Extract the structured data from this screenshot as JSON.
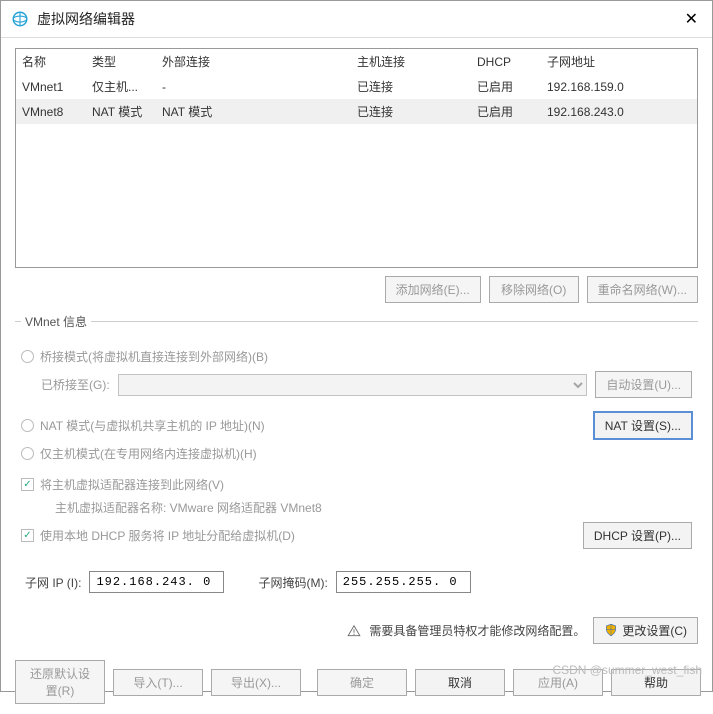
{
  "window": {
    "title": "虚拟网络编辑器"
  },
  "grid": {
    "headers": {
      "name": "名称",
      "type": "类型",
      "ext": "外部连接",
      "host": "主机连接",
      "dhcp": "DHCP",
      "subnet": "子网地址"
    },
    "rows": [
      {
        "name": "VMnet1",
        "type": "仅主机...",
        "ext": "-",
        "host": "已连接",
        "dhcp": "已启用",
        "subnet": "192.168.159.0"
      },
      {
        "name": "VMnet8",
        "type": "NAT 模式",
        "ext": "NAT 模式",
        "host": "已连接",
        "dhcp": "已启用",
        "subnet": "192.168.243.0"
      }
    ]
  },
  "buttons": {
    "add_net": "添加网络(E)...",
    "remove_net": "移除网络(O)",
    "rename_net": "重命名网络(W)...",
    "auto_set": "自动设置(U)...",
    "nat_set": "NAT 设置(S)...",
    "dhcp_set": "DHCP 设置(P)...",
    "change_set": "更改设置(C)",
    "restore": "还原默认设置(R)",
    "import": "导入(T)...",
    "export": "导出(X)...",
    "ok": "确定",
    "cancel": "取消",
    "apply": "应用(A)",
    "help": "帮助"
  },
  "info": {
    "legend": "VMnet 信息",
    "bridge": "桥接模式(将虚拟机直接连接到外部网络)(B)",
    "bridge_to": "已桥接至(G):",
    "nat": "NAT 模式(与虚拟机共享主机的 IP 地址)(N)",
    "hostonly": "仅主机模式(在专用网络内连接虚拟机)(H)",
    "connect_adapter": "将主机虚拟适配器连接到此网络(V)",
    "adapter_name": "主机虚拟适配器名称: VMware 网络适配器 VMnet8",
    "use_dhcp": "使用本地 DHCP 服务将 IP 地址分配给虚拟机(D)",
    "subnet_ip_label": "子网 IP (I):",
    "subnet_ip": "192.168.243. 0",
    "mask_label": "子网掩码(M):",
    "mask": "255.255.255. 0"
  },
  "warn": "需要具备管理员特权才能修改网络配置。",
  "watermark": "CSDN @summer_west_fish"
}
